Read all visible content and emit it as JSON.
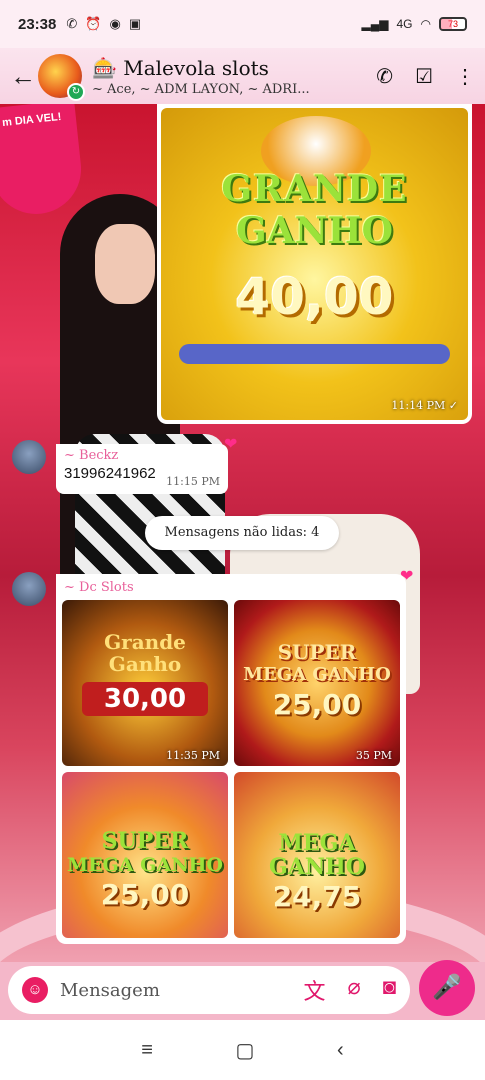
{
  "status_bar": {
    "time": "23:38",
    "network": "4G",
    "battery": "73"
  },
  "header": {
    "title": "🎰 Malevola slots",
    "subtitle": "~ Ace, ~ ADM LAYON, ~ ADRI..."
  },
  "wallpaper": {
    "sign_text": "m DIA VEL!"
  },
  "messages": [
    {
      "type": "image",
      "caption_line1": "GRANDE",
      "caption_line2": "GANHO",
      "amount": "40,00",
      "time": "11:14 PM",
      "status": "✓"
    },
    {
      "type": "text",
      "sender": "~ Beckz",
      "text": "31996241962",
      "time": "11:15 PM"
    }
  ],
  "unread_divider": "Mensagens não lidas: 4",
  "album": {
    "sender": "~ Dc Slots",
    "tiles": [
      {
        "line1": "Grande",
        "line2": "Ganho",
        "amount": "30,00",
        "time": "11:35 PM"
      },
      {
        "line1": "SUPER",
        "line2": "MEGA GANHO",
        "amount": "25,00",
        "time": "35 PM"
      },
      {
        "line1": "SUPER",
        "line2": "MEGA GANHO",
        "amount": "25,00",
        "time": ""
      },
      {
        "line1": "MEGA",
        "line2": "GANHO",
        "amount": "24,75",
        "time": ""
      }
    ]
  },
  "input": {
    "placeholder": "Mensagem"
  },
  "colors": {
    "accent": "#ee2b8b",
    "header_bg": "#fbe4ee",
    "sender": "#e8609a"
  }
}
